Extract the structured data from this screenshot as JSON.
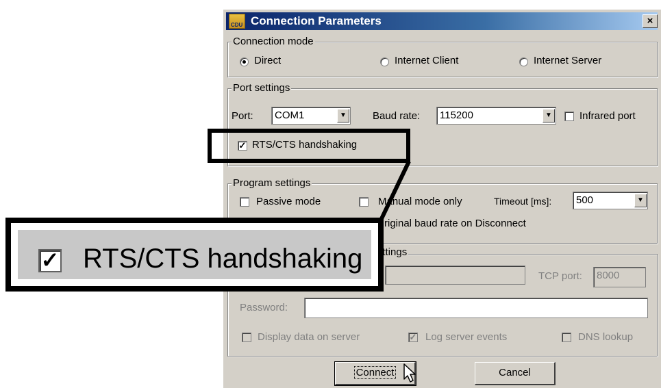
{
  "window": {
    "title": "Connection Parameters",
    "close_glyph": "×",
    "icon_text": "CDU"
  },
  "connection_mode": {
    "legend": "Connection mode",
    "options": [
      {
        "label": "Direct",
        "selected": true
      },
      {
        "label": "Internet Client",
        "selected": false
      },
      {
        "label": "Internet Server",
        "selected": false
      }
    ]
  },
  "port_settings": {
    "legend": "Port settings",
    "port_label": "Port:",
    "port_value": "COM1",
    "baud_label": "Baud rate:",
    "baud_value": "115200",
    "infrared_label": "Infrared port",
    "infrared_checked": false,
    "rts_label": "RTS/CTS handshaking",
    "rts_checked": true
  },
  "program_settings": {
    "legend": "Program settings",
    "passive_label": "Passive mode",
    "manual_label": "Manual mode only",
    "timeout_label": "Timeout [ms]:",
    "timeout_value": "500",
    "restore_label": "riginal baud rate on Disconnect"
  },
  "internet_settings": {
    "legend_partial": "ettings",
    "tcp_label": "TCP port:",
    "tcp_value": "8000",
    "password_label": "Password:",
    "display_label": "Display data on server",
    "log_label": "Log server events",
    "log_checked": true,
    "dns_label": "DNS lookup"
  },
  "buttons": {
    "connect": "Connect",
    "cancel": "Cancel"
  },
  "callout": {
    "label": "RTS/CTS handshaking",
    "checked": true
  },
  "icons": {
    "check": "✓",
    "dropdown": "▼",
    "window_icon": "app-icon",
    "cursor": "arrow-cursor-icon"
  },
  "colors": {
    "title_gradient_start": "#0a246a",
    "title_gradient_end": "#a6caf0",
    "dialog_face": "#d4d0c8",
    "highlight_border": "#000000"
  }
}
